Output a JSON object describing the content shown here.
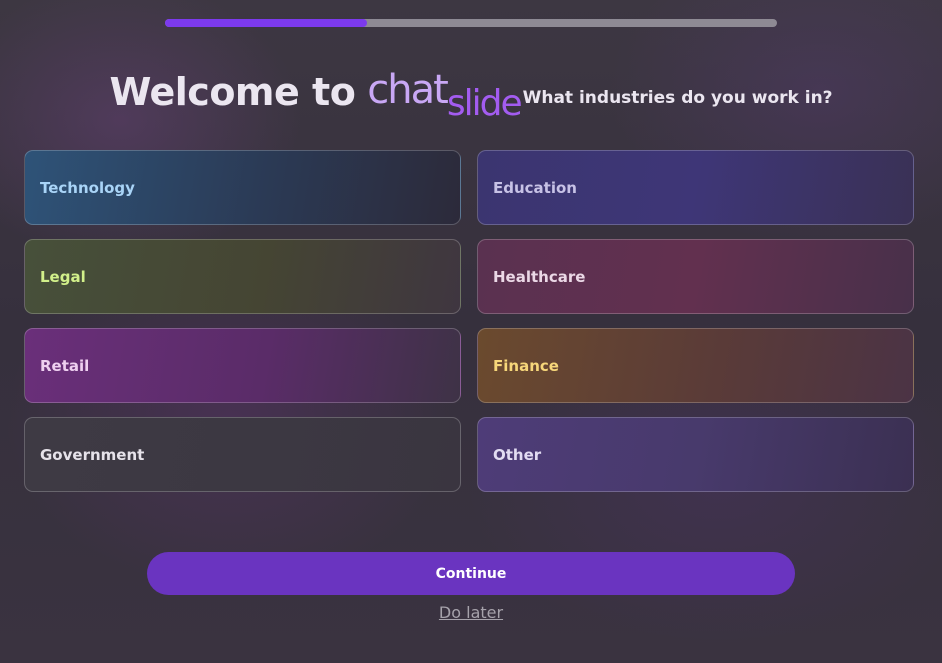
{
  "onboarding": {
    "progress_fraction": 0.33,
    "heading": {
      "welcome_text": "Welcome to",
      "logo_part1": "chat",
      "logo_part2": "slide",
      "question": "What industries do you work in?"
    },
    "options": [
      "Technology",
      "Education",
      "Legal",
      "Healthcare",
      "Retail",
      "Finance",
      "Government",
      "Other"
    ],
    "continue_label": "Continue",
    "do_later_label": "Do later"
  },
  "colors": {
    "accent": "#7c3aed",
    "button": "#6a34c0",
    "logo_light": "#c9a8f5",
    "logo_dark": "#a35cf0"
  }
}
